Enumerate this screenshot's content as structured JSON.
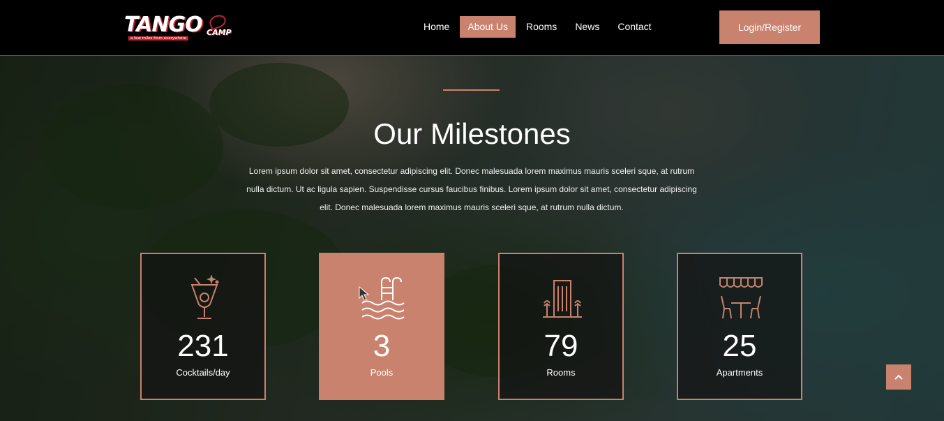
{
  "header": {
    "logo": {
      "word": "TANGO",
      "sub": "CAMP",
      "tagline": "a few miles from everywhere"
    },
    "nav": [
      {
        "label": "Home",
        "active": false
      },
      {
        "label": "About Us",
        "active": true
      },
      {
        "label": "Rooms",
        "active": false
      },
      {
        "label": "News",
        "active": false
      },
      {
        "label": "Contact",
        "active": false
      }
    ],
    "login_label": "Login/Register"
  },
  "milestones": {
    "title": "Our Milestones",
    "description": "Lorem ipsum dolor sit amet, consectetur adipiscing elit. Donec malesuada lorem maximus mauris sceleri sque, at rutrum nulla dictum. Ut ac ligula sapien. Suspendisse cursus faucibus finibus. Lorem ipsum dolor sit amet, consectetur adipiscing elit. Donec malesuada lorem maximus mauris sceleri sque, at rutrum nulla dictum.",
    "cards": [
      {
        "number": "231",
        "label": "Cocktails/day",
        "icon": "cocktail-icon",
        "highlight": false
      },
      {
        "number": "3",
        "label": "Pools",
        "icon": "pool-icon",
        "highlight": true
      },
      {
        "number": "79",
        "label": "Rooms",
        "icon": "hotel-building-icon",
        "highlight": false
      },
      {
        "number": "25",
        "label": "Apartments",
        "icon": "cafe-table-icon",
        "highlight": false
      }
    ]
  },
  "colors": {
    "accent": "#c9826e",
    "header_bg": "#000000",
    "logo_red": "#c0272d"
  }
}
